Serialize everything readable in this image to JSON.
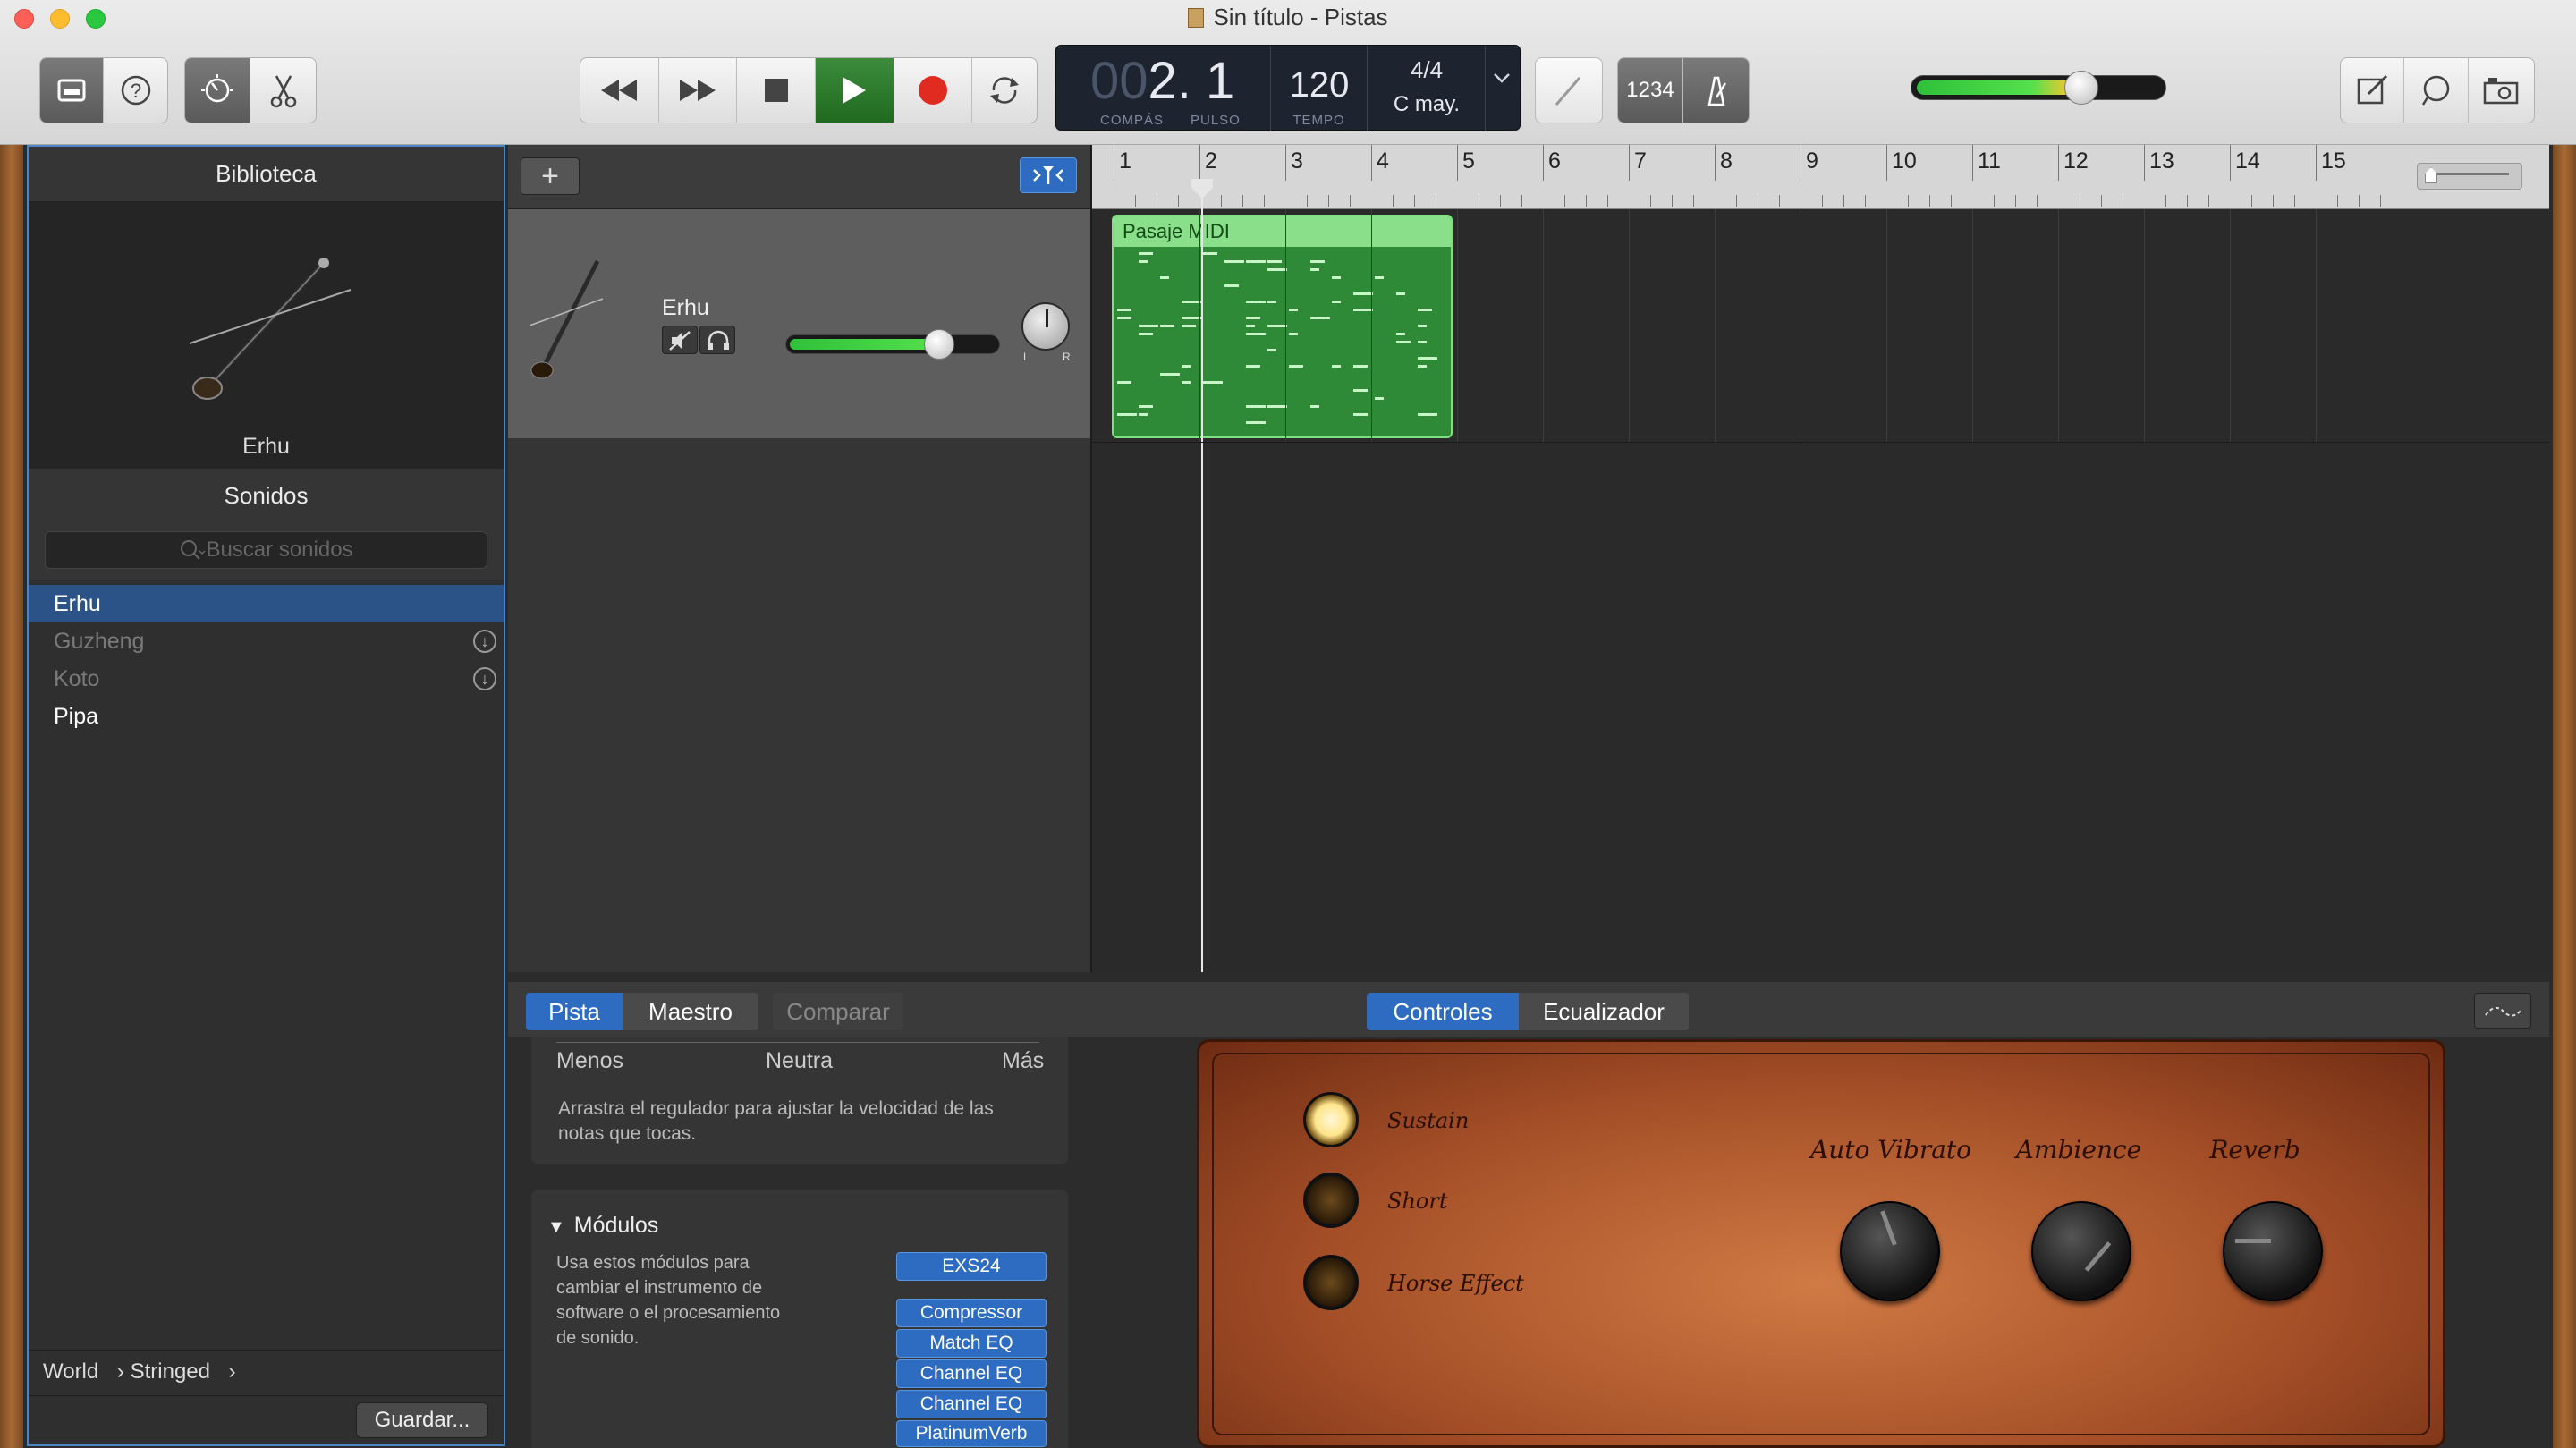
{
  "window": {
    "title": "Sin título - Pistas"
  },
  "toolbar": {
    "library_icon": "library-icon",
    "help_icon": "help-icon",
    "smart_controls_icon": "smart-controls-icon",
    "editors_icon": "scissors-icon",
    "rewind_icon": "rewind-icon",
    "forward_icon": "fast-forward-icon",
    "stop_icon": "stop-icon",
    "play_icon": "play-icon",
    "record_icon": "record-icon",
    "cycle_icon": "cycle-icon",
    "tuner_icon": "tuner-icon",
    "count_in_label": "1234",
    "metronome_icon": "metronome-icon",
    "notepad_icon": "notepad-icon",
    "loops_icon": "loops-icon",
    "media_icon": "media-icon",
    "master_volume": 0.68
  },
  "lcd": {
    "bar_dim": "00",
    "position": "2. 1",
    "bar_label": "COMPÁS",
    "beat_label": "PULSO",
    "tempo": "120",
    "tempo_label": "TEMPO",
    "signature": "4/4",
    "key": "C may."
  },
  "library": {
    "title": "Biblioteca",
    "instrument_name": "Erhu",
    "sounds_title": "Sonidos",
    "search_placeholder": "Buscar sonidos",
    "sounds": [
      {
        "label": "Erhu",
        "selected": true,
        "download": false
      },
      {
        "label": "Guzheng",
        "selected": false,
        "download": true
      },
      {
        "label": "Koto",
        "selected": false,
        "download": true
      },
      {
        "label": "Pipa",
        "selected": false,
        "download": false
      }
    ],
    "breadcrumb": [
      "World",
      "Stringed"
    ],
    "save_label": "Guardar..."
  },
  "tracks": {
    "add_label": "+",
    "track_name": "Erhu",
    "track_volume": 0.72,
    "pan_labels": [
      "L",
      "R"
    ],
    "region_name": "Pasaje MIDI",
    "bars": [
      "1",
      "2",
      "3",
      "4",
      "5",
      "6",
      "7",
      "8",
      "9",
      "10",
      "11",
      "12",
      "13",
      "14",
      "15"
    ]
  },
  "bottom": {
    "tabs_left": [
      "Pista",
      "Maestro",
      "Comparar"
    ],
    "tabs_right": [
      "Controles",
      "Ecualizador"
    ],
    "velocity": {
      "less": "Menos",
      "neutral": "Neutra",
      "more": "Más",
      "help": "Arrastra el regulador para ajustar la velocidad de las notas que tocas."
    },
    "modules": {
      "title": "Módulos",
      "description": "Usa estos módulos para cambiar el instrumento de software o el procesamiento de sonido.",
      "plugins": [
        "EXS24",
        "Compressor",
        "Match EQ",
        "Channel EQ",
        "Channel EQ",
        "PlatinumVerb"
      ]
    },
    "amp": {
      "switches": [
        "Sustain",
        "Short",
        "Horse Effect"
      ],
      "knobs": [
        "Auto Vibrato",
        "Ambience",
        "Reverb"
      ]
    }
  }
}
